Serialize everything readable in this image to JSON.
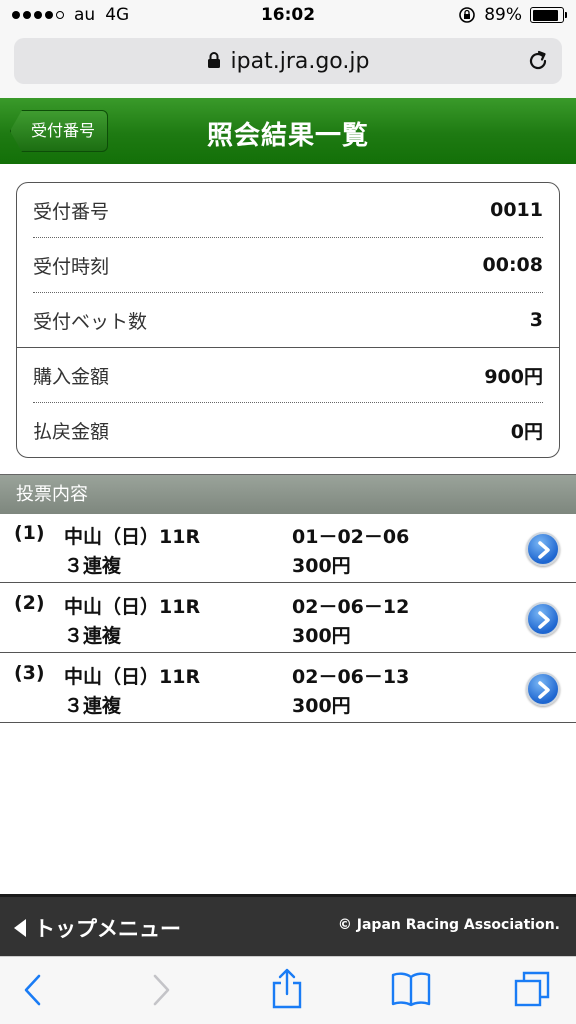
{
  "status_bar": {
    "carrier": "au",
    "network": "4G",
    "time": "16:02",
    "battery": "89%",
    "battery_level": 0.89
  },
  "browser": {
    "url": "ipat.jra.go.jp"
  },
  "header": {
    "back_label": "受付番号",
    "title": "照会結果一覧",
    "color": "#1e7a12"
  },
  "summary": {
    "rows": [
      {
        "label": "受付番号",
        "value": "0011"
      },
      {
        "label": "受付時刻",
        "value": "00:08"
      },
      {
        "label": "受付ベット数",
        "value": "3"
      },
      {
        "label": "購入金額",
        "value": "900円"
      },
      {
        "label": "払戻金額",
        "value": "0円"
      }
    ]
  },
  "section": {
    "title": "投票内容"
  },
  "tickets": [
    {
      "num": "(1)",
      "race": "中山（日）11R",
      "type": "３連複",
      "combo": "01－02－06",
      "amount": "300円"
    },
    {
      "num": "(2)",
      "race": "中山（日）11R",
      "type": "３連複",
      "combo": "02－06－12",
      "amount": "300円"
    },
    {
      "num": "(3)",
      "race": "中山（日）11R",
      "type": "３連複",
      "combo": "02－06－13",
      "amount": "300円"
    }
  ],
  "footer": {
    "menu_label": "トップメニュー",
    "copyright": "© Japan Racing Association."
  },
  "toolbar": {
    "icons": [
      "back-arrow-icon",
      "forward-arrow-icon",
      "share-icon",
      "bookmarks-icon",
      "tabs-icon"
    ]
  }
}
